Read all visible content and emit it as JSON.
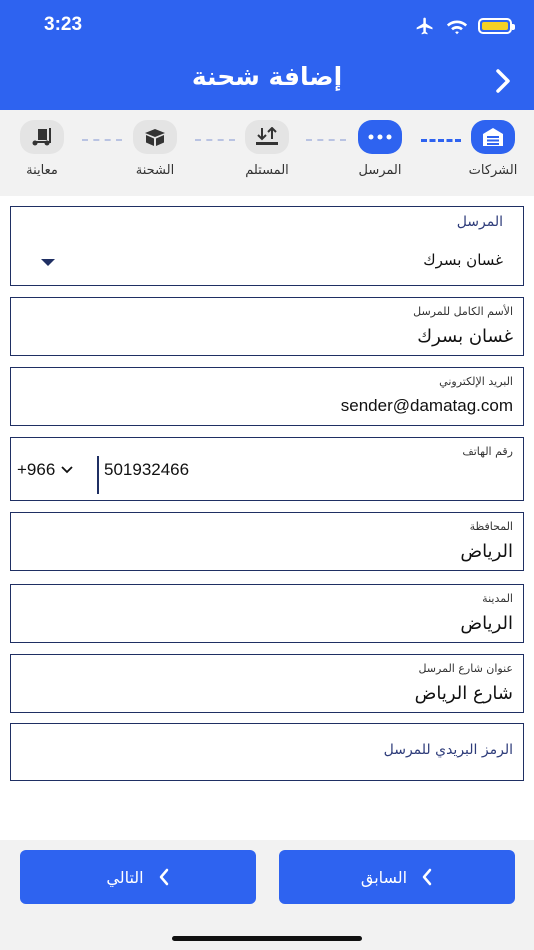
{
  "status_bar": {
    "time": "3:23"
  },
  "header": {
    "title": "إضافة شحنة"
  },
  "stepper": {
    "steps": [
      {
        "label": "الشركات",
        "icon": "garage-icon",
        "active": true
      },
      {
        "label": "المرسل",
        "icon": "more-dots-icon",
        "active": true
      },
      {
        "label": "المستلم",
        "icon": "receive-arrow-icon",
        "active": false
      },
      {
        "label": "الشحنة",
        "icon": "open-box-icon",
        "active": false
      },
      {
        "label": "معاينة",
        "icon": "hand-truck-icon",
        "active": false
      }
    ]
  },
  "form": {
    "sender_select": {
      "label": "المرسل",
      "value": "غسان بسرك"
    },
    "full_name": {
      "label": "الأسم الكامل للمرسل",
      "value": "غسان بسرك"
    },
    "email": {
      "label": "البريد الإلكتروني",
      "value": "sender@damatag.com"
    },
    "phone": {
      "label": "رقم الهاتف",
      "country_code": "+966",
      "number": "501932466"
    },
    "province": {
      "label": "المحافظة",
      "value": "الرياض"
    },
    "city": {
      "label": "المدينة",
      "value": "الرياض"
    },
    "street": {
      "label": "عنوان شارع المرسل",
      "value": "شارع الرياض"
    },
    "postal_code": {
      "placeholder": "الرمز البريدي للمرسل"
    }
  },
  "footer": {
    "prev_label": "السابق",
    "next_label": "التالي"
  },
  "colors": {
    "primary": "#2e63f0",
    "border": "#1f2f63",
    "battery": "#f5d024"
  }
}
